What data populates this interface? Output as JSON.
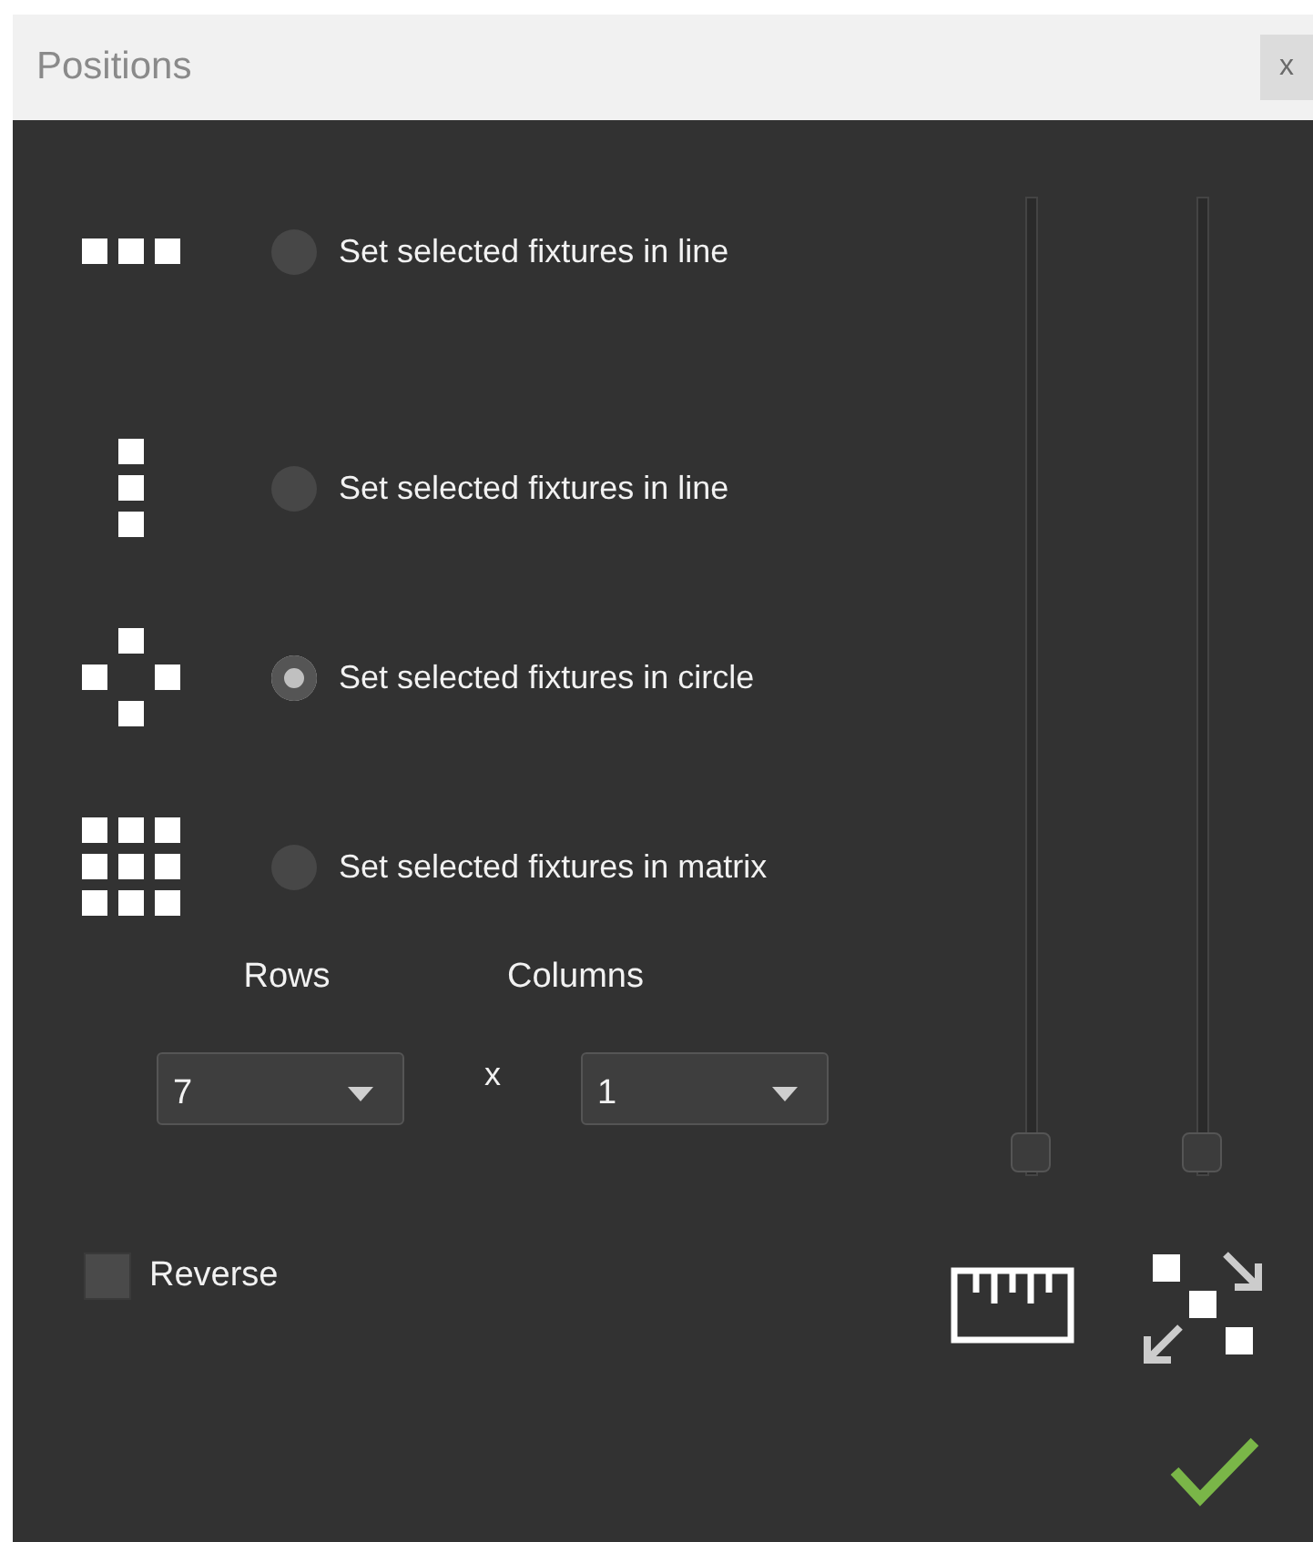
{
  "window": {
    "title": "Positions",
    "close": "x"
  },
  "options": [
    {
      "kind": "row",
      "label": "Set selected fixtures in line",
      "selected": false
    },
    {
      "kind": "column",
      "label": "Set selected fixtures in line",
      "selected": false
    },
    {
      "kind": "circle",
      "label": "Set selected fixtures in circle",
      "selected": true
    },
    {
      "kind": "matrix",
      "label": "Set selected fixtures in matrix",
      "selected": false
    }
  ],
  "matrix": {
    "rows_label": "Rows",
    "columns_label": "Columns",
    "rows_value": "7",
    "separator": "x",
    "columns_value": "1"
  },
  "reverse": {
    "label": "Reverse",
    "checked": false
  },
  "sliders": [
    {
      "level": 0
    },
    {
      "level": 0
    }
  ]
}
